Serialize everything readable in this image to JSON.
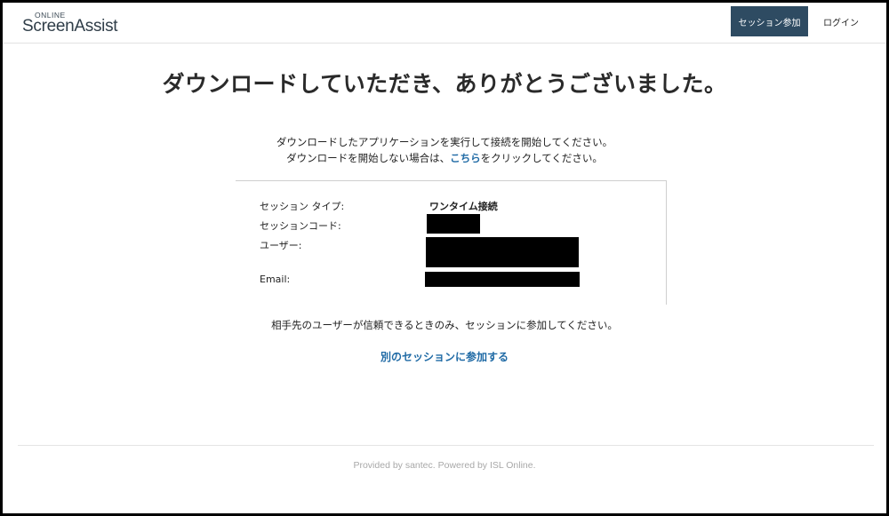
{
  "header": {
    "logo_small": "ONLINE",
    "logo_main": "ScreenAssist",
    "join_session_label": "セッション参加",
    "login_label": "ログイン"
  },
  "main": {
    "title": "ダウンロードしていただき、ありがとうございました。",
    "instruction_line1": "ダウンロードしたアプリケーションを実行して接続を開始してください。",
    "instruction_line2_prefix": "ダウンロードを開始しない場合は、",
    "instruction_line2_link": "こちら",
    "instruction_line2_suffix": "をクリックしてください。"
  },
  "session_info": {
    "type_label": "セッション タイプ:",
    "type_value": "ワンタイム接続",
    "code_label": "セッションコード:",
    "user_label": "ユーザー:",
    "email_label": "Email:"
  },
  "notice": "相手先のユーザーが信頼できるときのみ、セッションに参加してください。",
  "other_session_link": "別のセッションに参加する",
  "footer": "Provided by santec. Powered by ISL Online."
}
